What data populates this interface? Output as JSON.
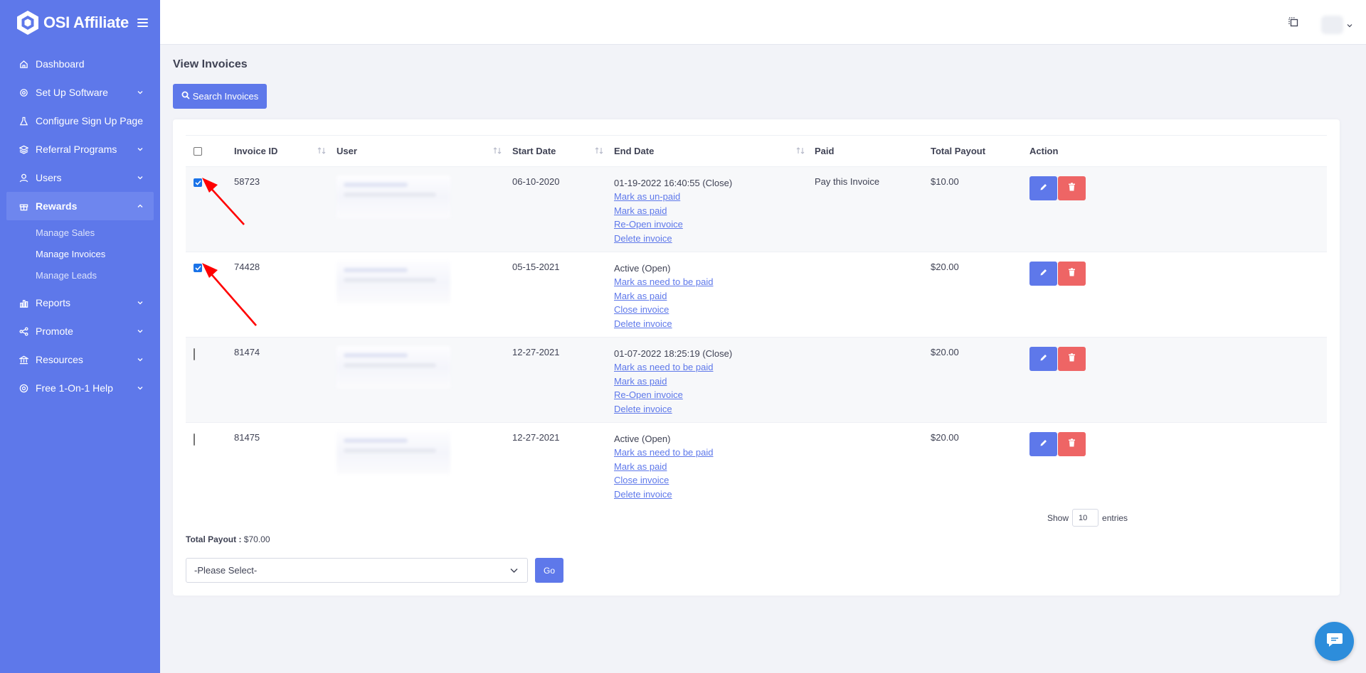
{
  "brand": {
    "name": "OSI Affiliate"
  },
  "sidebar": {
    "items": [
      {
        "label": "Dashboard",
        "icon": "home-icon"
      },
      {
        "label": "Set Up Software",
        "icon": "gear-icon"
      },
      {
        "label": "Configure Sign Up Page",
        "icon": "flask-icon"
      },
      {
        "label": "Referral Programs",
        "icon": "stack-icon"
      },
      {
        "label": "Users",
        "icon": "user-icon"
      },
      {
        "label": "Rewards",
        "icon": "gift-icon"
      },
      {
        "label": "Reports",
        "icon": "bar-chart-icon"
      },
      {
        "label": "Promote",
        "icon": "share-icon"
      },
      {
        "label": "Resources",
        "icon": "bank-icon"
      },
      {
        "label": "Free 1-On-1 Help",
        "icon": "lifebuoy-icon"
      }
    ],
    "rewards_sub": [
      {
        "label": "Manage Sales"
      },
      {
        "label": "Manage Invoices"
      },
      {
        "label": "Manage Leads"
      }
    ]
  },
  "page": {
    "title": "View Invoices",
    "search_button": "Search Invoices"
  },
  "table": {
    "headers": {
      "invoice_id": "Invoice ID",
      "user": "User",
      "start_date": "Start Date",
      "end_date": "End Date",
      "paid": "Paid",
      "total_payout": "Total Payout",
      "action": "Action"
    },
    "rows": [
      {
        "checked": true,
        "invoice_id": "58723",
        "start_date": "06-10-2020",
        "status": "01-19-2022 16:40:55 (Close)",
        "links": [
          "Mark as un-paid",
          "Mark as paid",
          "Re-Open invoice",
          "Delete invoice"
        ],
        "paid": "Pay this Invoice",
        "total_payout": "$10.00"
      },
      {
        "checked": true,
        "invoice_id": "74428",
        "start_date": "05-15-2021",
        "status": "Active (Open)",
        "links": [
          "Mark as need to be paid",
          "Mark as paid",
          "Close invoice",
          "Delete invoice"
        ],
        "paid": "",
        "total_payout": "$20.00"
      },
      {
        "checked": false,
        "invoice_id": "81474",
        "start_date": "12-27-2021",
        "status": "01-07-2022 18:25:19 (Close)",
        "links": [
          "Mark as need to be paid",
          "Mark as paid",
          "Re-Open invoice",
          "Delete invoice"
        ],
        "paid": "",
        "total_payout": "$20.00"
      },
      {
        "checked": false,
        "invoice_id": "81475",
        "start_date": "12-27-2021",
        "status": "Active (Open)",
        "links": [
          "Mark as need to be paid",
          "Mark as paid",
          "Close invoice",
          "Delete invoice"
        ],
        "paid": "",
        "total_payout": "$20.00"
      }
    ]
  },
  "footer": {
    "show_label": "Show",
    "entries_value": "10",
    "entries_label": "entries",
    "total_payout_label": "Total Payout :",
    "total_payout_value": "$70.00",
    "select_value": "-Please Select-",
    "go_button": "Go"
  },
  "colors": {
    "sidebar": "#5e78ea",
    "accent": "#5e78ea",
    "danger": "#ee6565",
    "annotation_arrow": "#ff0000"
  }
}
